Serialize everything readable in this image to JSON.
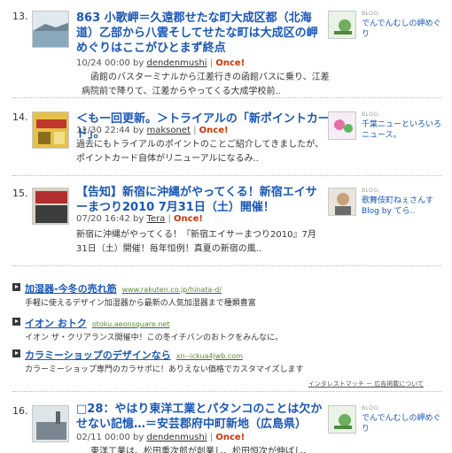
{
  "entries": [
    {
      "number": "13.",
      "title": "863 小歌岬＝久遠郡せたな町大成区都（北海道）乙部から八雲そしてせたな町は大成区の岬めぐりはここがひとまず終点",
      "date": "10/24",
      "time": "00:00",
      "by": "by",
      "author": "dendenmushi",
      "once": "Once!",
      "excerpt": "　函館のバスターミナルから江差行きの函館バスに乗り、江差病院前で降りて、江差からやってくる大成学校前..",
      "blog": {
        "label": "BLOG:",
        "name": "でんでんむしの岬めぐり"
      }
    },
    {
      "number": "14.",
      "title": "＜もー回更新。＞トライアルの「新ポイントカード」。",
      "date": "11/30",
      "time": "22:44",
      "by": "by",
      "author": "maksonet",
      "once": "Once!",
      "excerpt": "過去にもトライアルのポイントのことご紹介してきましたが、 ポイントカード自体がリニューアルになるみ..",
      "blog": {
        "label": "BLOG:",
        "name": "千葉ニューといろいろニュース。"
      }
    },
    {
      "number": "15.",
      "title": "【告知】新宿に沖縄がやってくる！新宿エイサーまつり2010 7月31日（土）開催！",
      "date": "07/20",
      "time": "16:42",
      "by": "by",
      "author": "Tera",
      "once": "Once!",
      "excerpt": "新宿に沖縄がやってくる！『新宿エイサーまつり2010』7月31日（土）開催！毎年恒例！真夏の新宿の風..",
      "blog": {
        "label": "BLOG:",
        "name": "歌舞伎町ねぇさんすBlog by てら.."
      }
    },
    {
      "number": "16.",
      "title": "□28：やはり東洋工業とパタンコのことは欠かせない記憶…＝安芸郡府中町新地（広島県）",
      "date": "02/11",
      "time": "00:00",
      "by": "by",
      "author": "dendenmushi",
      "once": "Once!",
      "excerpt": "　東洋工業は、松田重次郎が創業し、松田恒次が伸ばし、",
      "blog": {
        "label": "BLOG:",
        "name": "でんでんむしの岬めぐり"
      }
    }
  ],
  "ads": [
    {
      "title": "加湿器-今冬の売れ筋",
      "url": "www.rakuten.co.jp/hinata-d/",
      "desc": "手軽に使えるデザイン加湿器から最新の人気加湿器まで種類豊富"
    },
    {
      "title": "イオン おトク",
      "url": "otoku.aeonsquare.net",
      "desc": "イオン ザ・クリアランス開催中！この冬イチバンのおトクをみんなに。"
    },
    {
      "title": "カラミーショップのデザインなら",
      "url": "xn--ickua4jwb.com",
      "desc": "カラーミーショップ専門のカラサポに！ありえない価格でカスタマイズします"
    }
  ],
  "ad_footer": "インタレストマッチ － 広告掲載について",
  "colors": {
    "link": "#1a57b8",
    "once": "#cc3300",
    "ad_url": "#5c8a2e"
  }
}
